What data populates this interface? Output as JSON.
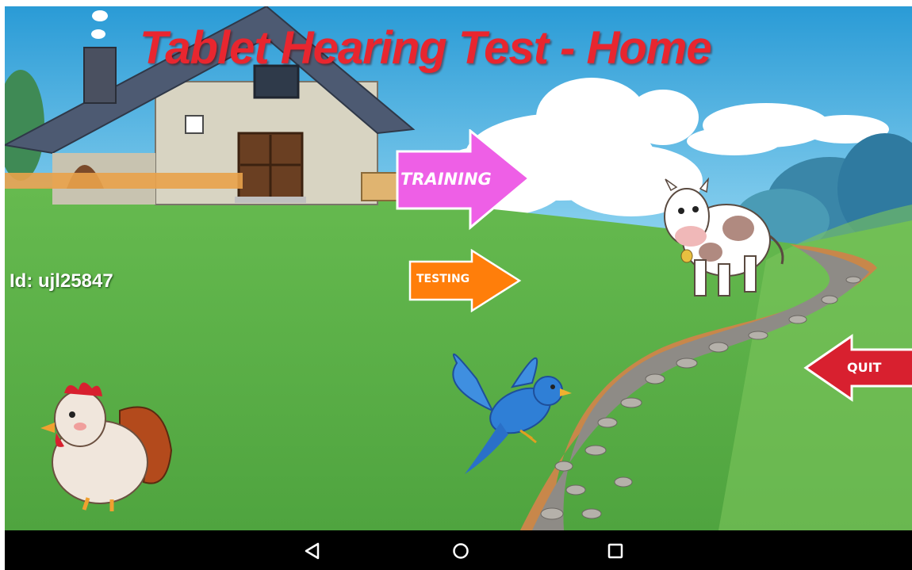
{
  "app": {
    "title": "Tablet Hearing Test - Home",
    "user_id": "Id: ujl25847"
  },
  "buttons": {
    "training": "TRAINING",
    "testing": "TESTING",
    "quit": "QUIT"
  },
  "colors": {
    "title": "#e8262f",
    "training": "#ee5fe6",
    "testing": "#ff7e0a",
    "quit": "#d8202f",
    "grass": "#5cb14a",
    "sky": "#3aa8de"
  },
  "navbar": {
    "back_icon": "back-triangle-icon",
    "home_icon": "home-circle-icon",
    "recents_icon": "recents-square-icon"
  },
  "illustrations": [
    "farmhouse",
    "rooster",
    "cow",
    "blue-bird",
    "cobblestone-path",
    "clouds"
  ]
}
